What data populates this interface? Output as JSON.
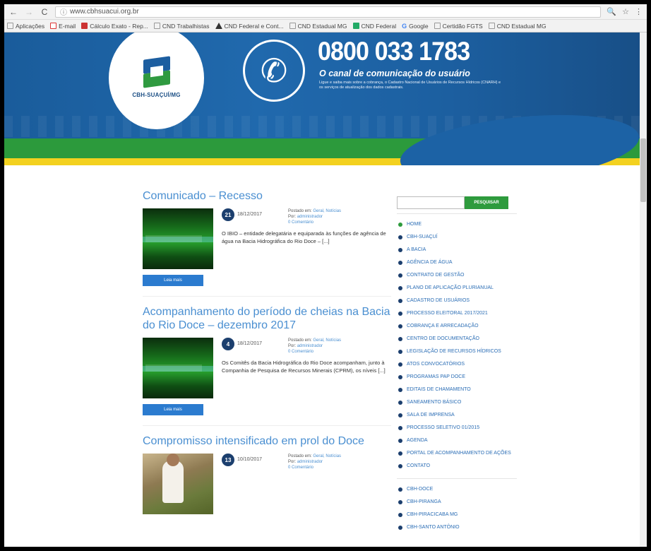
{
  "browser": {
    "url": "www.cbhsuacui.org.br",
    "nav": {
      "back": "←",
      "forward": "→",
      "reload": "C",
      "zoom": "🔍",
      "star": "☆",
      "menu": "⋮"
    }
  },
  "bookmarks": [
    {
      "label": "Aplicações",
      "icon": "apps-icon"
    },
    {
      "label": "E-mail",
      "icon": "gmail-icon"
    },
    {
      "label": "Cálculo Exato - Rep...",
      "icon": "calc-icon"
    },
    {
      "label": "CND Trabalhistas",
      "icon": "page-icon"
    },
    {
      "label": "CND Federal e Cont...",
      "icon": "warning-icon"
    },
    {
      "label": "CND Estadual MG",
      "icon": "page-icon"
    },
    {
      "label": "CND Federal",
      "icon": "grid-icon"
    },
    {
      "label": "Google",
      "icon": "google-icon"
    },
    {
      "label": "Certidão FGTS",
      "icon": "page-icon"
    },
    {
      "label": "CND Estadual MG",
      "icon": "page-icon"
    }
  ],
  "header": {
    "logo_text": "CBH-SUAÇUÍ/MG",
    "phone": "0800 033 1783",
    "phone_sub": "O canal de comunicação do usuário",
    "phone_desc": "Ligue e saiba mais sobre a cobrança, o Cadastro Nacional de Usuários de Recursos Hídricos (CNARH) e os serviços de atualização dos dados cadastrais."
  },
  "posts": [
    {
      "title": "Comunicado – Recesso",
      "day": "21",
      "date": "18/12/2017",
      "posted_label": "Postado em:",
      "category": "Geral, Notícias",
      "by_label": "Por:",
      "author": "administrador",
      "comments": "0 Comentário",
      "excerpt": "O IBIO – entidade delegatária e equiparada às funções de agência de água na Bacia Hidrográfica do Rio Doce – [...]",
      "read_more": "Leia mais",
      "thumb": "river"
    },
    {
      "title": "Acompanhamento do período de cheias na Bacia do Rio Doce – dezembro 2017",
      "day": "4",
      "date": "18/12/2017",
      "posted_label": "Postado em:",
      "category": "Geral, Notícias",
      "by_label": "Por:",
      "author": "administrador",
      "comments": "0 Comentário",
      "excerpt": "Os Comitês da Bacia Hidrográfica do Rio Doce acompanham, junto à Companhia de Pesquisa de Recursos Minerais (CPRM), os níveis [...]",
      "read_more": "Leia mais",
      "thumb": "river"
    },
    {
      "title": "Compromisso intensificado em prol do Doce",
      "day": "13",
      "date": "10/10/2017",
      "posted_label": "Postado em:",
      "category": "Geral, Notícias",
      "by_label": "Por:",
      "author": "administrador",
      "comments": "0 Comentário",
      "excerpt": "",
      "read_more": "",
      "thumb": "photo"
    }
  ],
  "sidebar": {
    "search_placeholder": "",
    "search_button": "PESQUISAR",
    "menu": [
      "HOME",
      "CBH-SUAÇUÍ",
      "A BACIA",
      "AGÊNCIA DE ÁGUA",
      "CONTRATO DE GESTÃO",
      "PLANO DE APLICAÇÃO PLURIANUAL",
      "CADASTRO DE USUÁRIOS",
      "PROCESSO ELEITORAL 2017/2021",
      "COBRANÇA E ARRECADAÇÃO",
      "CENTRO DE DOCUMENTAÇÃO",
      "LEGISLAÇÃO DE RECURSOS HÍDRICOS",
      "ATOS CONVOCATÓRIOS",
      "PROGRAMAS PAP DOCE",
      "EDITAIS DE CHAMAMENTO",
      "SANEAMENTO BÁSICO",
      "SALA DE IMPRENSA",
      "PROCESSO SELETIVO 01/2015",
      "AGENDA",
      "PORTAL DE ACOMPANHAMENTO DE AÇÕES",
      "CONTATO"
    ],
    "menu2": [
      "CBH-DOCE",
      "CBH-PIRANGA",
      "CBH-PIRACICABA MG",
      "CBH-SANTO ANTÔNIO"
    ]
  },
  "colors": {
    "banner_blue": "#1b5f9e",
    "green": "#2e9b3d",
    "yellow": "#f3d11f",
    "link": "#4a8fd1"
  }
}
